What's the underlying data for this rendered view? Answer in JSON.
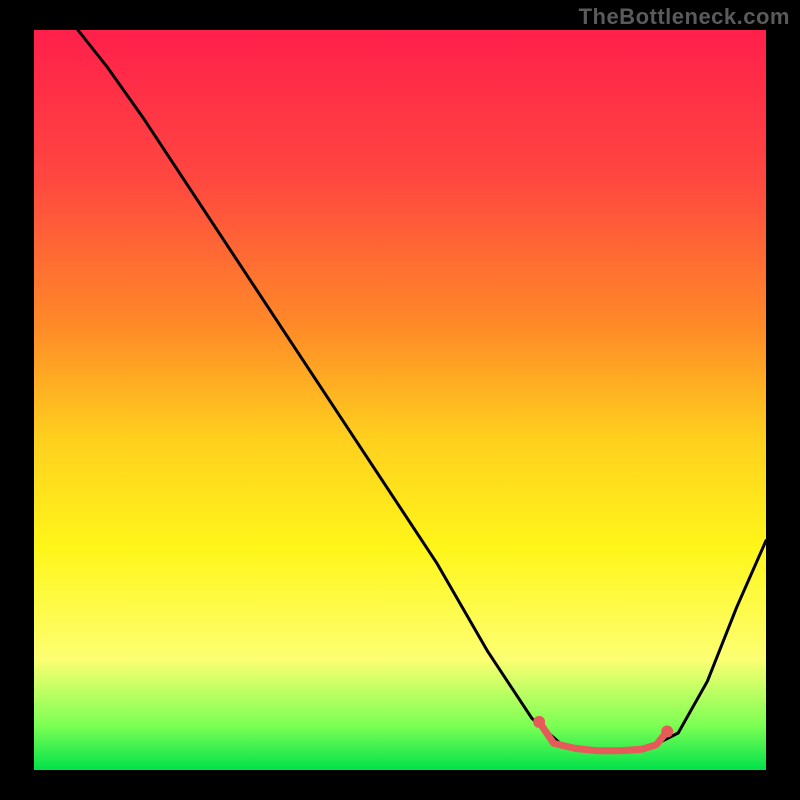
{
  "watermark": "TheBottleneck.com",
  "chart_data": {
    "type": "line",
    "title": "",
    "xlabel": "",
    "ylabel": "",
    "xlim": [
      0,
      100
    ],
    "ylim": [
      0,
      100
    ],
    "background_gradient": {
      "stops": [
        {
          "offset": 0.0,
          "color": "#ff1f4b"
        },
        {
          "offset": 0.2,
          "color": "#ff4740"
        },
        {
          "offset": 0.4,
          "color": "#ff8a28"
        },
        {
          "offset": 0.55,
          "color": "#ffcf1e"
        },
        {
          "offset": 0.7,
          "color": "#fff61a"
        },
        {
          "offset": 0.85,
          "color": "#fdff72"
        },
        {
          "offset": 0.94,
          "color": "#7cff54"
        },
        {
          "offset": 1.0,
          "color": "#00e24a"
        }
      ]
    },
    "curve": {
      "note": "Approximate chart-space (0–100) coordinates of the black curve. y=0 is bottom, y=100 is top.",
      "points": [
        {
          "x": 6,
          "y": 100
        },
        {
          "x": 10,
          "y": 95
        },
        {
          "x": 15,
          "y": 88
        },
        {
          "x": 25,
          "y": 73
        },
        {
          "x": 35,
          "y": 58
        },
        {
          "x": 45,
          "y": 43
        },
        {
          "x": 55,
          "y": 28
        },
        {
          "x": 62,
          "y": 16
        },
        {
          "x": 68,
          "y": 7
        },
        {
          "x": 72,
          "y": 3.5
        },
        {
          "x": 76,
          "y": 2.8
        },
        {
          "x": 80,
          "y": 2.6
        },
        {
          "x": 84,
          "y": 3.0
        },
        {
          "x": 88,
          "y": 5
        },
        {
          "x": 92,
          "y": 12
        },
        {
          "x": 96,
          "y": 22
        },
        {
          "x": 100,
          "y": 31
        }
      ]
    },
    "highlight": {
      "note": "Coral/red highlighted region near the bottom of the valley.",
      "color": "#e65a5a",
      "points": [
        {
          "x": 69,
          "y": 6.5
        },
        {
          "x": 71,
          "y": 3.6
        },
        {
          "x": 74,
          "y": 2.9
        },
        {
          "x": 77,
          "y": 2.6
        },
        {
          "x": 80,
          "y": 2.6
        },
        {
          "x": 83,
          "y": 2.8
        },
        {
          "x": 85,
          "y": 3.4
        },
        {
          "x": 86.5,
          "y": 5.2
        }
      ],
      "end_dots": [
        {
          "x": 69,
          "y": 6.5
        },
        {
          "x": 86.5,
          "y": 5.2
        }
      ]
    }
  }
}
